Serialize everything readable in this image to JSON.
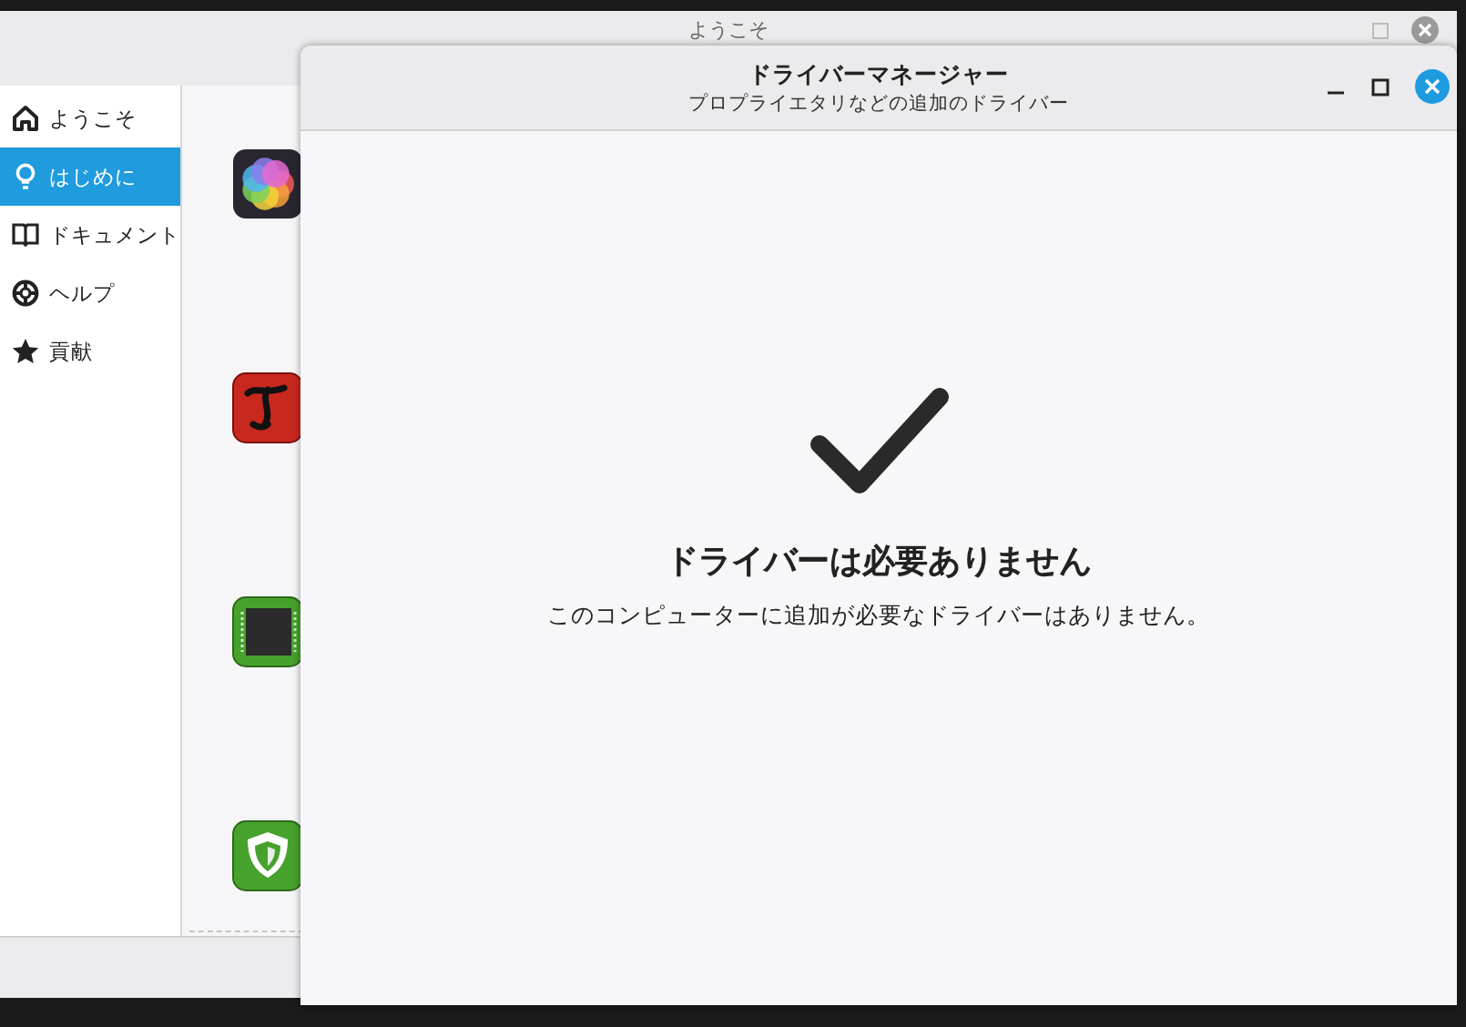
{
  "welcome_window": {
    "title": "ようこそ",
    "sidebar": [
      {
        "label": "ようこそ",
        "kind": "home",
        "selected": false
      },
      {
        "label": "はじめに",
        "kind": "bulb",
        "selected": true
      },
      {
        "label": "ドキュメント",
        "kind": "book",
        "selected": false
      },
      {
        "label": "ヘルプ",
        "kind": "lifebuoy",
        "selected": false
      },
      {
        "label": "貢献",
        "kind": "star",
        "selected": false
      }
    ],
    "apps": [
      {
        "kind": "photos"
      },
      {
        "kind": "font"
      },
      {
        "kind": "chip"
      },
      {
        "kind": "shield"
      }
    ]
  },
  "driver_window": {
    "title": "ドライバーマネージャー",
    "subtitle": "プロプライエタリなどの追加のドライバー",
    "heading": "ドライバーは必要ありません",
    "message": "このコンピューターに追加が必要なドライバーはありません。"
  }
}
